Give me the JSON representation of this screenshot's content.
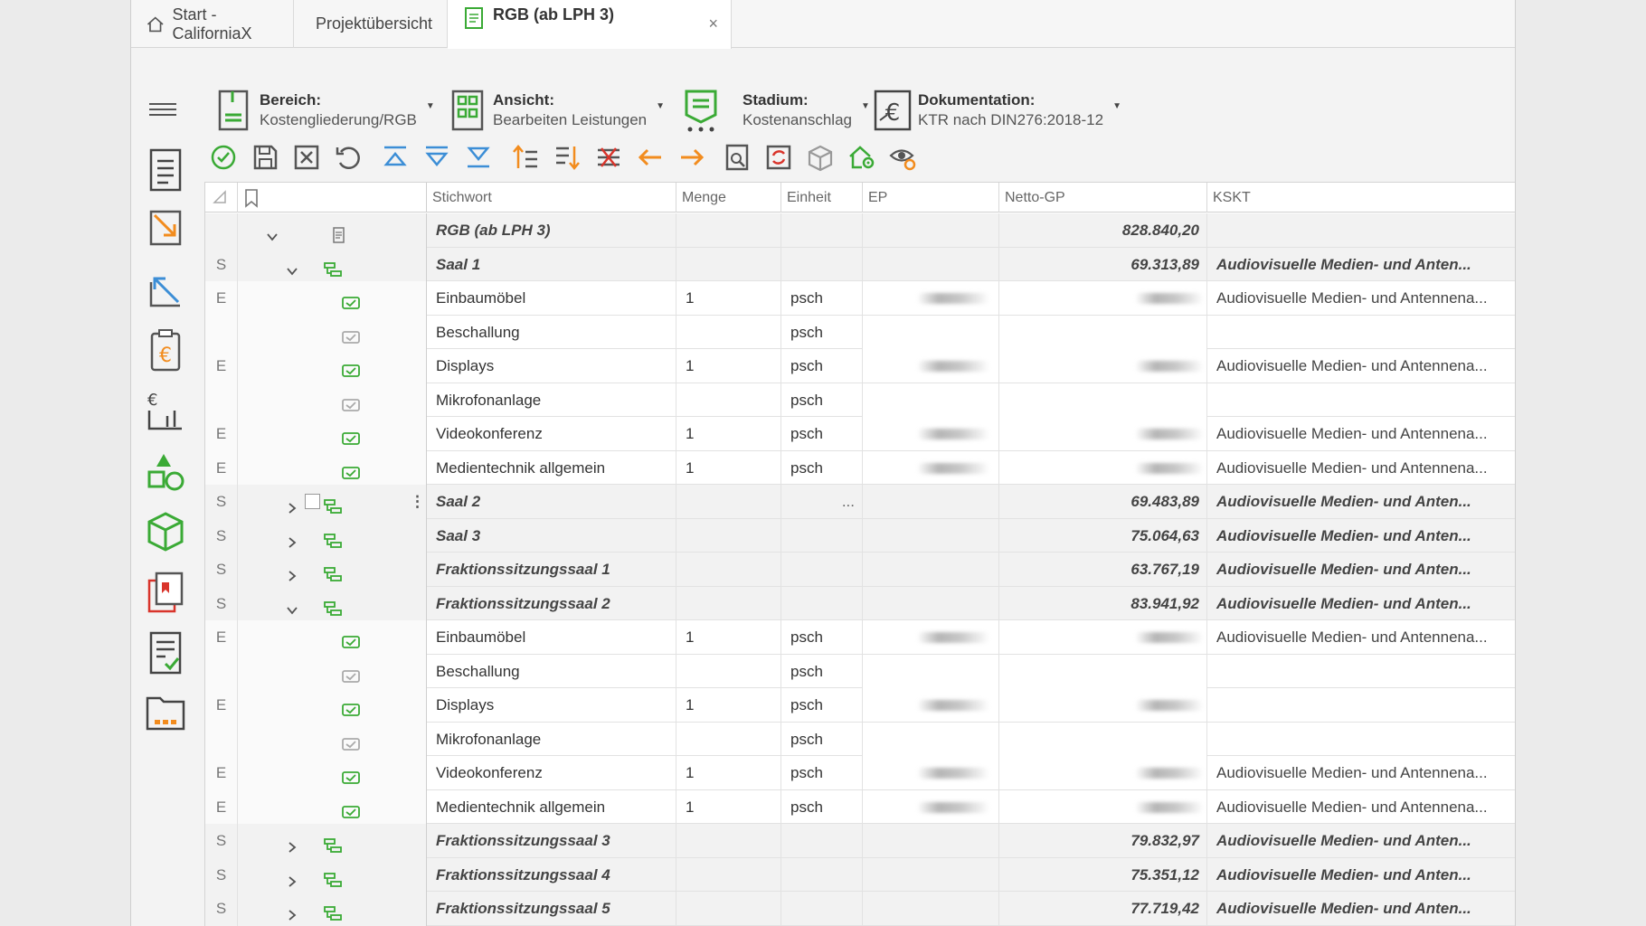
{
  "tabs": [
    {
      "label": "Start - CaliforniaX",
      "icon": "home-icon"
    },
    {
      "label": "Projektübersicht",
      "icon": "document-icon"
    },
    {
      "label": "RGB (ab LPH 3)",
      "icon": "document-icon",
      "active": true
    }
  ],
  "close_symbol": "×",
  "selectors": {
    "bereich": {
      "title": "Bereich:",
      "value": "Kostengliederung/RGB"
    },
    "ansicht": {
      "title": "Ansicht:",
      "value": "Bearbeiten Leistungen"
    },
    "stadium": {
      "title": "Stadium:",
      "value": "Kostenanschlag"
    },
    "dokumentation": {
      "title": "Dokumentation:",
      "value": "KTR nach DIN276:2018-12"
    }
  },
  "columns": {
    "stichwort": "Stichwort",
    "menge": "Menge",
    "einheit": "Einheit",
    "ep": "EP",
    "netto": "Netto-GP",
    "kskt": "KSKT"
  },
  "rows": [
    {
      "type": "",
      "kind": "root",
      "stichwort": "RGB (ab LPH 3)",
      "menge": "",
      "einheit": "",
      "netto": "828.840,20",
      "kskt": ""
    },
    {
      "type": "S",
      "kind": "group-open",
      "stichwort": "Saal 1",
      "menge": "",
      "einheit": "",
      "netto": "69.313,89",
      "kskt": "Audiovisuelle Medien- und Anten..."
    },
    {
      "type": "E",
      "kind": "item",
      "active": true,
      "stichwort": "Einbaumöbel",
      "menge": "1",
      "einheit": "psch",
      "netto": "",
      "kskt": "Audiovisuelle Medien- und Antennena..."
    },
    {
      "type": "",
      "kind": "item",
      "active": false,
      "stichwort": "Beschallung",
      "menge": "",
      "einheit": "psch",
      "netto": "",
      "kskt": ""
    },
    {
      "type": "E",
      "kind": "item",
      "active": true,
      "stichwort": "Displays",
      "menge": "1",
      "einheit": "psch",
      "netto": "",
      "kskt": "Audiovisuelle Medien- und Antennena..."
    },
    {
      "type": "",
      "kind": "item",
      "active": false,
      "stichwort": "Mikrofonanlage",
      "menge": "",
      "einheit": "psch",
      "netto": "",
      "kskt": ""
    },
    {
      "type": "E",
      "kind": "item",
      "active": true,
      "stichwort": "Videokonferenz",
      "menge": "1",
      "einheit": "psch",
      "netto": "",
      "kskt": "Audiovisuelle Medien- und Antennena..."
    },
    {
      "type": "E",
      "kind": "item",
      "active": true,
      "stichwort": "Medientechnik allgemein",
      "menge": "1",
      "einheit": "psch",
      "netto": "",
      "kskt": "Audiovisuelle Medien- und Antennena..."
    },
    {
      "type": "S",
      "kind": "group-closed-hover",
      "stichwort": "Saal 2",
      "menge": "",
      "einheit": "...",
      "netto": "69.483,89",
      "kskt": "Audiovisuelle Medien- und Anten..."
    },
    {
      "type": "S",
      "kind": "group-closed",
      "stichwort": "Saal 3",
      "menge": "",
      "einheit": "",
      "netto": "75.064,63",
      "kskt": "Audiovisuelle Medien- und Anten..."
    },
    {
      "type": "S",
      "kind": "group-closed",
      "stichwort": "Fraktionssitzungssaal  1",
      "menge": "",
      "einheit": "",
      "netto": "63.767,19",
      "kskt": "Audiovisuelle Medien- und Anten..."
    },
    {
      "type": "S",
      "kind": "group-open",
      "stichwort": "Fraktionssitzungssaal 2",
      "menge": "",
      "einheit": "",
      "netto": "83.941,92",
      "kskt": "Audiovisuelle Medien- und Anten..."
    },
    {
      "type": "E",
      "kind": "item",
      "active": true,
      "stichwort": "Einbaumöbel",
      "menge": "1",
      "einheit": "psch",
      "netto": "",
      "kskt": "Audiovisuelle Medien- und Antennena..."
    },
    {
      "type": "",
      "kind": "item",
      "active": false,
      "stichwort": "Beschallung",
      "menge": "",
      "einheit": "psch",
      "netto": "",
      "kskt": ""
    },
    {
      "type": "E",
      "kind": "item",
      "active": true,
      "stichwort": "Displays",
      "menge": "1",
      "einheit": "psch",
      "netto": "",
      "kskt": ""
    },
    {
      "type": "",
      "kind": "item",
      "active": false,
      "stichwort": "Mikrofonanlage",
      "menge": "",
      "einheit": "psch",
      "netto": "",
      "kskt": ""
    },
    {
      "type": "E",
      "kind": "item",
      "active": true,
      "stichwort": "Videokonferenz",
      "menge": "1",
      "einheit": "psch",
      "netto": "",
      "kskt": "Audiovisuelle Medien- und Antennena..."
    },
    {
      "type": "E",
      "kind": "item",
      "active": true,
      "stichwort": "Medientechnik allgemein",
      "menge": "1",
      "einheit": "psch",
      "netto": "",
      "kskt": "Audiovisuelle Medien- und Antennena..."
    },
    {
      "type": "S",
      "kind": "group-closed",
      "stichwort": "Fraktionssitzungssaal 3",
      "menge": "",
      "einheit": "",
      "netto": "79.832,97",
      "kskt": "Audiovisuelle Medien- und Anten..."
    },
    {
      "type": "S",
      "kind": "group-closed",
      "stichwort": "Fraktionssitzungssaal 4",
      "menge": "",
      "einheit": "",
      "netto": "75.351,12",
      "kskt": "Audiovisuelle Medien- und Anten..."
    },
    {
      "type": "S",
      "kind": "group-closed",
      "stichwort": "Fraktionssitzungssaal  5",
      "menge": "",
      "einheit": "",
      "netto": "77.719,42",
      "kskt": "Audiovisuelle Medien- und Anten..."
    }
  ],
  "colors": {
    "accent_green": "#3aaa35",
    "accent_blue": "#3c8ed6",
    "accent_orange": "#f28c1e",
    "accent_red": "#d9342b",
    "icon_gray": "#555555"
  }
}
